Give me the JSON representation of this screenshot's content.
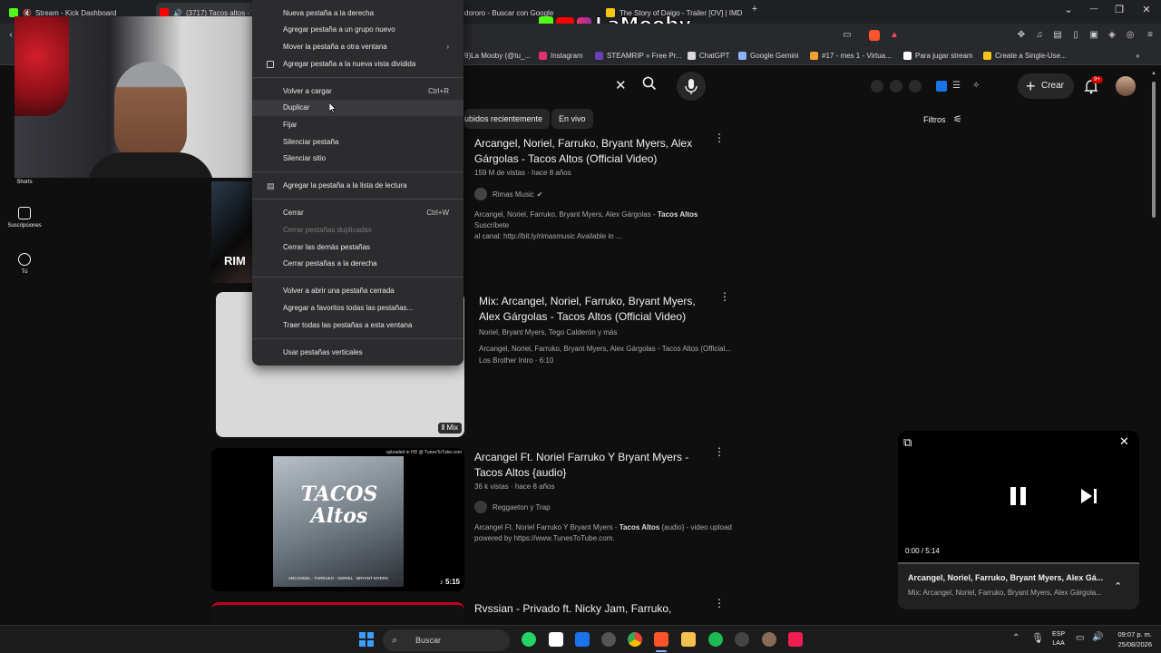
{
  "tabs": [
    {
      "label": "Stream - Kick Dashboard",
      "color": "#53fc18"
    },
    {
      "label": "(3717) Tacos altos - Yo",
      "color": "#ff0000"
    },
    {
      "label": "dororo - Buscar con Google",
      "color": "#4285f4"
    },
    {
      "label": "The Story of Daigo - Trailer [OV] | IMD",
      "color": "#f5c518"
    }
  ],
  "window_controls": {
    "new_tab": "+",
    "chevron": "⌄",
    "minimize": "—",
    "restore": "❐",
    "close": "✕"
  },
  "overlay": {
    "brand": "LaMooby"
  },
  "bookmarks": [
    {
      "label": "9)La Mooby (@tu_...",
      "color": "#444"
    },
    {
      "label": "Instagram",
      "color": "#e1306c"
    },
    {
      "label": "STEAMRIP » Free Pr...",
      "color": "#6a3fb8"
    },
    {
      "label": "ChatGPT",
      "color": "#d9d9d9"
    },
    {
      "label": "Google Gemini",
      "color": "#8ab4f8"
    },
    {
      "label": "#17 - mes 1 - Virtua...",
      "color": "#f0a030"
    },
    {
      "label": "Para jugar stream",
      "color": "#ffffff"
    },
    {
      "label": "Create a Single-Use...",
      "color": "#f5c518"
    }
  ],
  "youtube": {
    "create_label": "Crear",
    "notif_badge": "9+",
    "filters_label": "Filtros",
    "chips": [
      "ubidos recientemente",
      "En vivo"
    ],
    "sidebar": [
      {
        "label": "Shorts",
        "icon": "shorts-icon"
      },
      {
        "label": "Suscripciones",
        "icon": "subscriptions-icon"
      },
      {
        "label": "Tú",
        "icon": "you-icon"
      }
    ],
    "results": [
      {
        "title_l1": "Arcangel, Noriel, Farruko, Bryant Myers, Alex",
        "title_l2": "Gárgolas - Tacos Altos (Official Video)",
        "meta": "159 M de vistas · hace 8 años",
        "channel": "Rimas Music",
        "desc_pre": "Arcangel, Noriel, Farruko, Bryant Myers, Alex Gárgolas - ",
        "desc_bold": "Tacos Altos",
        "desc_post": " Suscríbete",
        "desc_l2": "al canal: http://bit.ly/rimasmusic Available in ..."
      },
      {
        "title_l1": "Mix: Arcangel, Noriel, Farruko, Bryant Myers,",
        "title_l2": "Alex Gárgolas - Tacos Altos (Official Video)",
        "meta": "Noriel, Bryant Myers, Tego Calderón y más",
        "desc_l1": "Arcangel, Noriel, Farruko, Bryant Myers, Alex Gárgolas - Tacos Altos (Official...",
        "desc_l2": "Los Brother Intro · 6:10",
        "badge": "Mix"
      },
      {
        "title_l1": "Arcangel Ft. Noriel Farruko Y Bryant Myers -",
        "title_l2": "Tacos Altos {audio}",
        "meta": "36 k vistas · hace 8 años",
        "channel": "Reggaeton y Trap",
        "desc_pre": "Arcangel Ft. Noriel Farruko Y Bryant Myers - ",
        "desc_bold": "Tacos Altos",
        "desc_post": " {audio} - video upload",
        "desc_l2": "powered by https://www.TunesToTube.com.",
        "duration": "5:15",
        "upload_note": "uploaded in HD @ TunesToTube.com",
        "cover_title": "TACOS Altos",
        "cover_artists": "ARCANGEL · FARRUKO · NORIEL · BRYANT MYERS"
      },
      {
        "title_l1": "Rvssian - Privado ft. Nicky Jam, Farruko,"
      }
    ],
    "thumb1_text": "RIM"
  },
  "context_menu": {
    "items": [
      {
        "label": "Nueva pestaña a la derecha",
        "shortcut": ""
      },
      {
        "label": "Agregar pestaña a un grupo nuevo",
        "shortcut": ""
      },
      {
        "label": "Mover la pestaña a otra ventana",
        "shortcut": "›"
      },
      {
        "label": "Agregar pestaña a la nueva vista dividida",
        "shortcut": ""
      },
      {
        "label": "Volver a cargar",
        "shortcut": "Ctrl+R"
      },
      {
        "label": "Duplicar",
        "shortcut": ""
      },
      {
        "label": "Fijar",
        "shortcut": ""
      },
      {
        "label": "Silenciar pestaña",
        "shortcut": ""
      },
      {
        "label": "Silenciar sitio",
        "shortcut": ""
      },
      {
        "label": "Agregar la pestaña a la lista de lectura",
        "shortcut": ""
      },
      {
        "label": "Cerrar",
        "shortcut": "Ctrl+W"
      },
      {
        "label": "Cerrar pestañas duplicadas",
        "shortcut": ""
      },
      {
        "label": "Cerrar las demás pestañas",
        "shortcut": ""
      },
      {
        "label": "Cerrar pestañas a la derecha",
        "shortcut": ""
      },
      {
        "label": "Volver a abrir una pestaña cerrada",
        "shortcut": ""
      },
      {
        "label": "Agregar a favoritos todas las pestañas...",
        "shortcut": ""
      },
      {
        "label": "Traer todas las pestañas a esta ventana",
        "shortcut": ""
      },
      {
        "label": "Usar pestañas verticales",
        "shortcut": ""
      }
    ]
  },
  "miniplayer": {
    "time": "0:00 / 5:14",
    "title": "Arcangel, Noriel, Farruko, Bryant Myers, Alex Gá...",
    "subtitle": "Mix: Arcangel, Noriel, Farruko, Bryant Myers, Alex Gárgola..."
  },
  "taskbar": {
    "search_placeholder": "Buscar",
    "lang_l1": "ESP",
    "lang_l2": "LAA",
    "time": "09:07 p. m.",
    "date": "25/08/2026"
  }
}
